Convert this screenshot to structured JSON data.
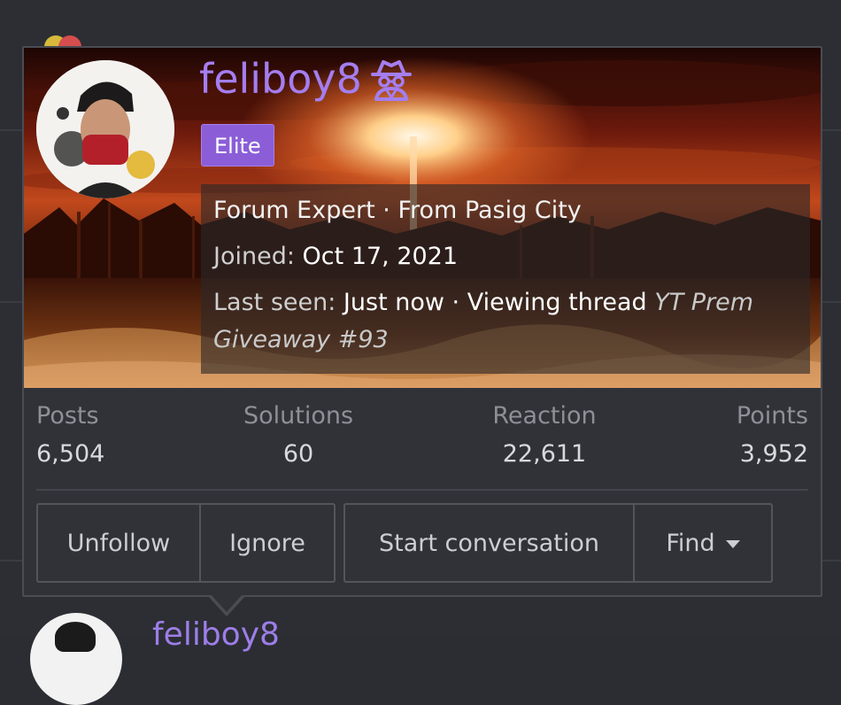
{
  "profile": {
    "username": "feliboy8",
    "username_icon": "incognito-spy-icon",
    "rank_badge": "Elite",
    "title": "Forum Expert",
    "location_prefix": "From",
    "location": "Pasig City",
    "joined_label": "Joined:",
    "joined_value": "Oct 17, 2021",
    "last_seen_label": "Last seen:",
    "last_seen_value": "Just now",
    "activity": "Viewing thread",
    "thread_title_part1": "YT Prem",
    "thread_title_part2": "Giveaway #93"
  },
  "stats": [
    {
      "label": "Posts",
      "value": "6,504"
    },
    {
      "label": "Solutions",
      "value": "60"
    },
    {
      "label": "Reaction",
      "value": "22,611"
    },
    {
      "label": "Points",
      "value": "3,952"
    }
  ],
  "actions": {
    "unfollow": "Unfollow",
    "ignore": "Ignore",
    "start_conversation": "Start conversation",
    "find": "Find"
  },
  "background_post": {
    "author": "feliboy8"
  },
  "colors": {
    "username": "#a47ef0",
    "badge": "#8b5ed8",
    "card_bg": "#303238",
    "page_bg": "#2b2d33"
  }
}
